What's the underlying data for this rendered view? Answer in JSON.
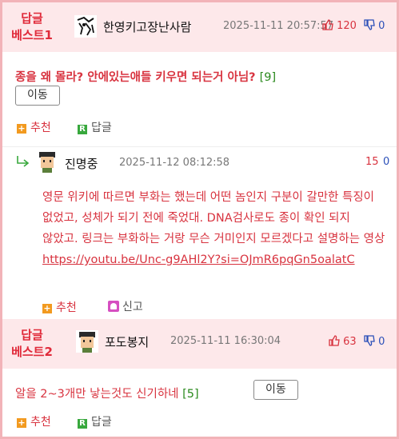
{
  "best1": {
    "badge_line1": "답글",
    "badge_line2": "베스트1",
    "nickname": "한영키고장난사람",
    "date": "2025-11-11 20:57:57",
    "upvotes": "120",
    "downvotes": "0",
    "title": "종을 왜 몰라? 안에있는애들 키우면 되는거 아님?",
    "reply_count": "[9]",
    "move_label": "이동",
    "recommend_label": "추천",
    "reply_label": "답글"
  },
  "comment": {
    "nickname": "진명중",
    "date": "2025-11-12 08:12:58",
    "upvotes": "15",
    "downvotes": "0",
    "body": "영문 위키에 따르면 부화는 했는데 어떤 놈인지 구분이 갈만한 특징이 없었고, 성체가 되기 전에 죽었대. DNA검사로도 종이 확인 되지 않았고. 링크는 부화하는 거랑 무슨 거미인지 모르겠다고 설명하는 영상",
    "link": "https://youtu.be/Unc-g9AHl2Y?si=OJmR6pqGn5oalatC",
    "recommend_label": "추천",
    "report_label": "신고"
  },
  "best2": {
    "badge_line1": "답글",
    "badge_line2": "베스트2",
    "nickname": "포도봉지",
    "date": "2025-11-11 16:30:04",
    "upvotes": "63",
    "downvotes": "0",
    "title": "알을 2~3개만 낳는것도 신기하네",
    "reply_count": "[5]",
    "move_label": "이동",
    "recommend_label": "추천",
    "reply_label": "답글"
  },
  "icons": {
    "recommend": "plus-square-icon",
    "reply": "reply-r-icon",
    "report": "siren-icon",
    "thumb_up": "thumb-up-icon",
    "thumb_down": "thumb-down-icon",
    "reply_arrow": "reply-arrow-icon"
  },
  "colors": {
    "accent_red": "#d8333f",
    "best_bg": "#fde8ea",
    "border_pink": "#f2b3b8",
    "count_green": "#2b8a1e",
    "down_blue": "#2b4fb8"
  }
}
